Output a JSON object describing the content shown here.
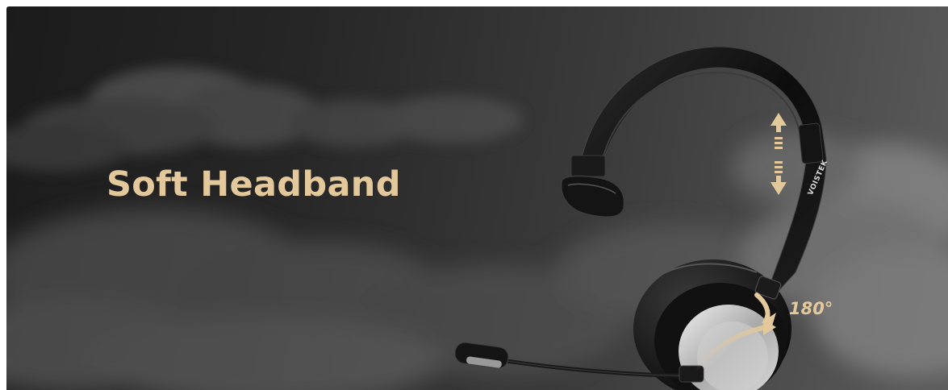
{
  "headline": "Soft Headband",
  "rotation_label": "180°",
  "brand": "VOISTEK",
  "colors": {
    "accent_gold": "#e2c89a",
    "background_dark": "#1b1b1b",
    "background_light": "#5c5c5c"
  },
  "icons": [
    "adjust-arrows-icon",
    "rotation-arrow-icon"
  ]
}
